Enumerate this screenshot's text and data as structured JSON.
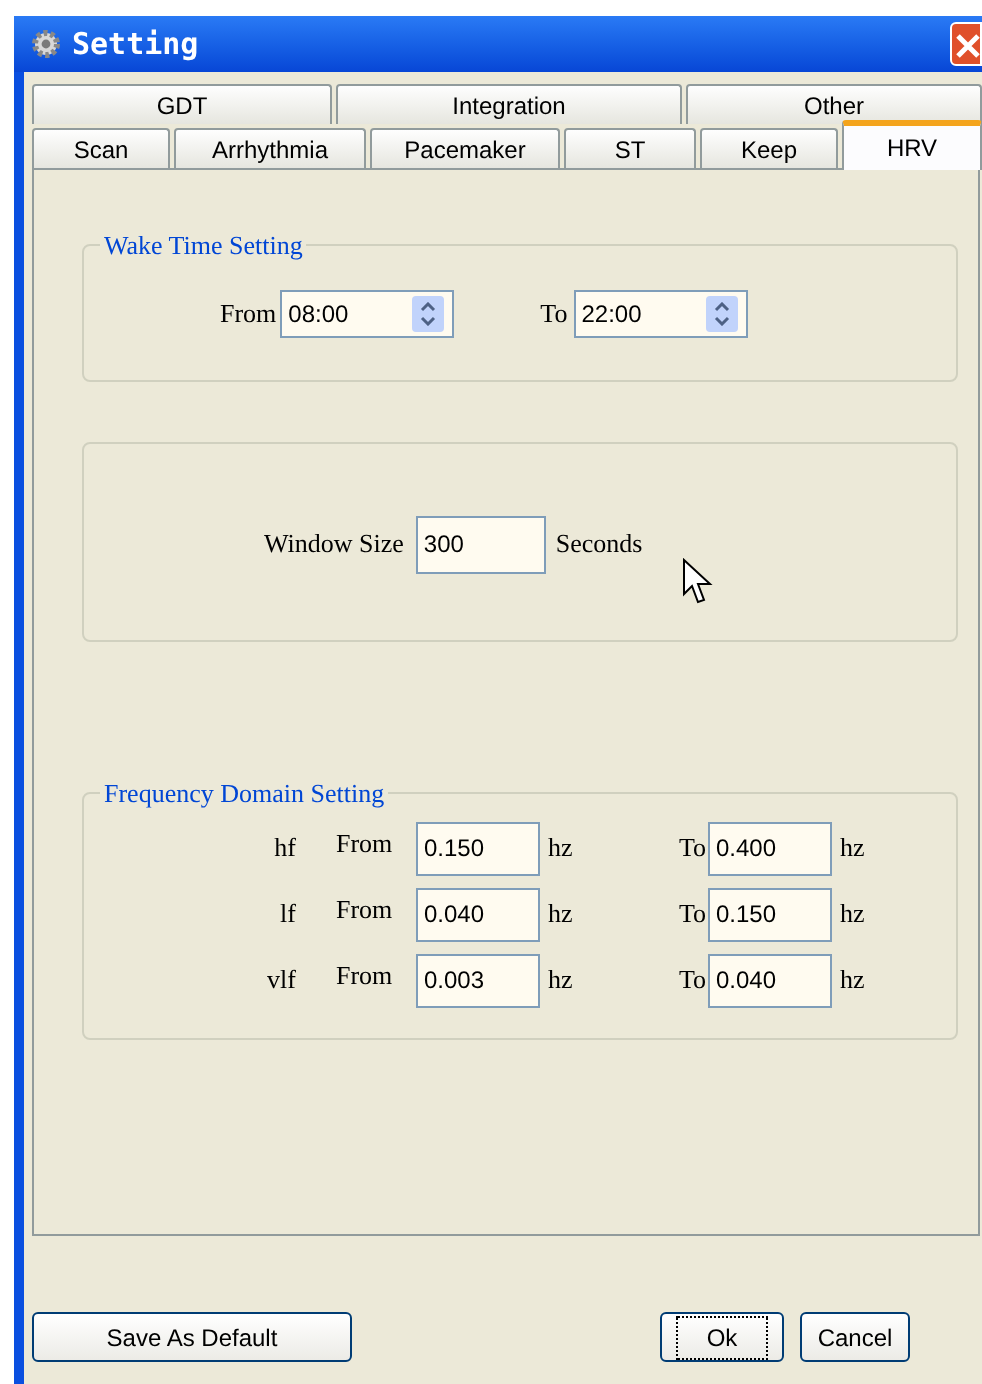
{
  "window": {
    "title": "Setting"
  },
  "tab_rows": [
    [
      {
        "label": "GDT",
        "selected": false
      },
      {
        "label": "Integration",
        "selected": false
      },
      {
        "label": "Other",
        "selected": false
      }
    ],
    [
      {
        "label": "Scan",
        "selected": false
      },
      {
        "label": "Arrhythmia",
        "selected": false
      },
      {
        "label": "Pacemaker",
        "selected": false
      },
      {
        "label": "ST",
        "selected": false
      },
      {
        "label": "Keep",
        "selected": false
      },
      {
        "label": "HRV",
        "selected": true
      }
    ]
  ],
  "wake_time": {
    "legend": "Wake Time Setting",
    "from_label": "From",
    "from_value": "08:00",
    "to_label": "To",
    "to_value": "22:00"
  },
  "window_size": {
    "label": "Window Size",
    "value": "300",
    "unit": "Seconds"
  },
  "frequency": {
    "legend": "Frequency Domain Setting",
    "rows": [
      {
        "band": "hf",
        "from_label": "From",
        "from_value": "0.150",
        "from_unit": "hz",
        "to_label": "To",
        "to_value": "0.400",
        "to_unit": "hz"
      },
      {
        "band": "lf",
        "from_label": "From",
        "from_value": "0.040",
        "from_unit": "hz",
        "to_label": "To",
        "to_value": "0.150",
        "to_unit": "hz"
      },
      {
        "band": "vlf",
        "from_label": "From",
        "from_value": "0.003",
        "from_unit": "hz",
        "to_label": "To",
        "to_value": "0.040",
        "to_unit": "hz"
      }
    ]
  },
  "buttons": [
    {
      "label": "Save As Default",
      "focused": false
    },
    {
      "label": "Ok",
      "focused": true
    },
    {
      "label": "Cancel",
      "focused": false
    }
  ]
}
